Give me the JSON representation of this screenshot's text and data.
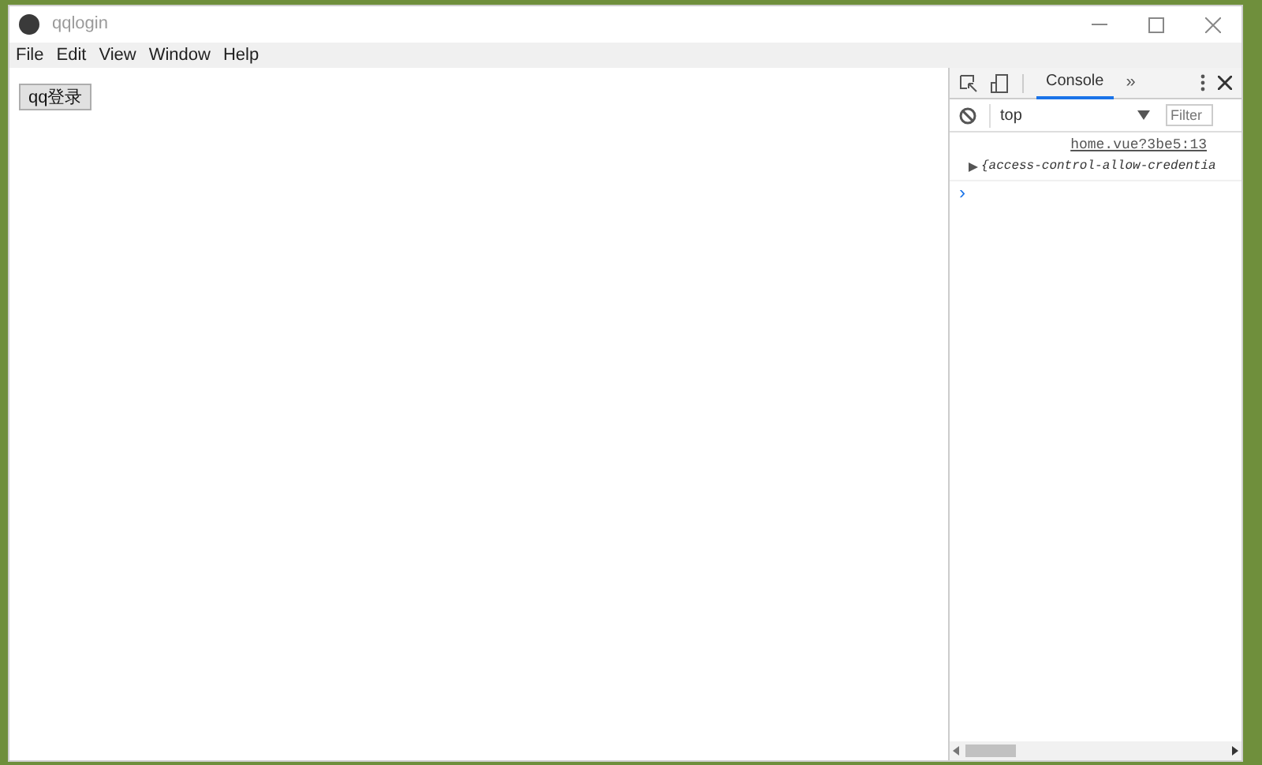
{
  "window": {
    "title": "qqlogin"
  },
  "menu": [
    "File",
    "Edit",
    "View",
    "Window",
    "Help"
  ],
  "page": {
    "button": "qq登录"
  },
  "devtools": {
    "tabs": [
      {
        "label": "Console",
        "selected": true
      }
    ],
    "more": "»",
    "context": "top",
    "filter": {
      "placeholder": "Filter"
    },
    "messages": [
      {
        "source": "home.vue?3be5:13",
        "text": "{access-control-allow-credentia",
        "expanded": false
      }
    ],
    "prompt": "›"
  }
}
